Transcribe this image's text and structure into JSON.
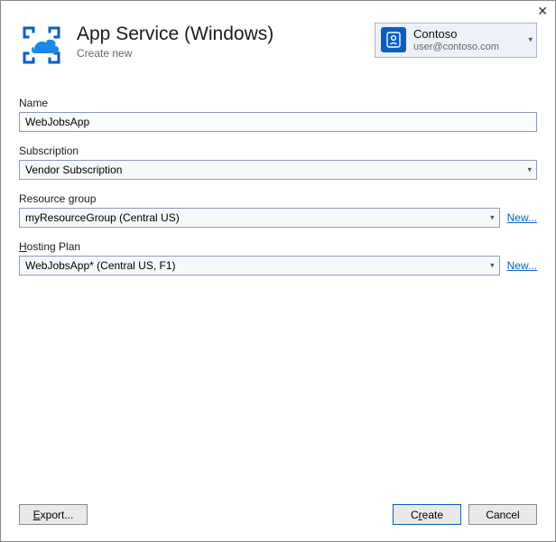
{
  "header": {
    "title": "App Service (Windows)",
    "subtitle": "Create new"
  },
  "account": {
    "name": "Contoso",
    "email": "user@contoso.com"
  },
  "fields": {
    "name": {
      "label": "Name",
      "value": "WebJobsApp"
    },
    "subscription": {
      "label": "Subscription",
      "value": "Vendor Subscription"
    },
    "resourceGroup": {
      "label": "Resource group",
      "value": "myResourceGroup (Central US)",
      "newLabel": "New..."
    },
    "hostingPlan": {
      "label": "Hosting Plan",
      "keyChar": "H",
      "rest": "osting Plan",
      "value": "WebJobsApp* (Central US, F1)",
      "newLabel": "New..."
    }
  },
  "footer": {
    "export": "Export...",
    "exportKey": "E",
    "exportRest": "xport...",
    "create": "Create",
    "createPre": "C",
    "createKey": "r",
    "createRest": "eate",
    "cancel": "Cancel"
  }
}
